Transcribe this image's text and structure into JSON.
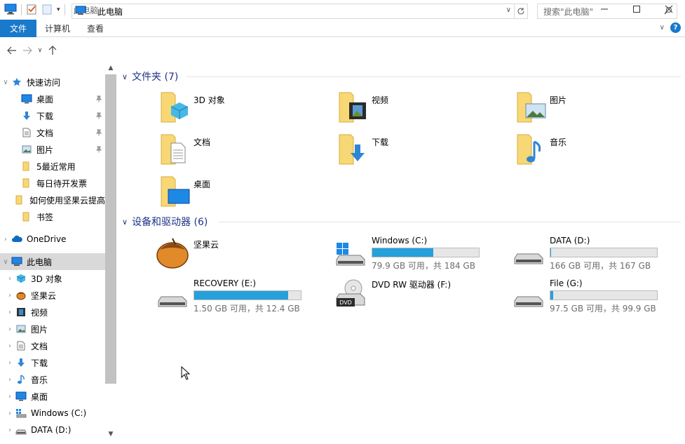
{
  "window": {
    "title": "此电脑",
    "controls": [
      "minimize",
      "maximize",
      "close"
    ]
  },
  "ribbon": {
    "tabs": [
      {
        "label": "文件",
        "active": true
      },
      {
        "label": "计算机",
        "active": false
      },
      {
        "label": "查看",
        "active": false
      }
    ]
  },
  "address": {
    "path": "此电脑",
    "search_placeholder": "搜索\"此电脑\""
  },
  "nav": {
    "quick_access": "快速访问",
    "quick_items": [
      {
        "label": "桌面",
        "icon": "desktop-icon",
        "pinned": true
      },
      {
        "label": "下载",
        "icon": "download-icon",
        "pinned": true
      },
      {
        "label": "文档",
        "icon": "document-icon",
        "pinned": true
      },
      {
        "label": "图片",
        "icon": "picture-icon",
        "pinned": true
      },
      {
        "label": "5最近常用",
        "icon": "folder-icon",
        "pinned": false
      },
      {
        "label": "每日待开发票",
        "icon": "folder-icon",
        "pinned": false
      },
      {
        "label": "如何使用坚果云提高",
        "icon": "folder-icon",
        "pinned": false
      },
      {
        "label": "书签",
        "icon": "folder-icon",
        "pinned": false
      }
    ],
    "onedrive": "OneDrive",
    "this_pc": "此电脑",
    "pc_items": [
      {
        "label": "3D 对象",
        "icon": "3d-objects-icon"
      },
      {
        "label": "坚果云",
        "icon": "nutstore-icon"
      },
      {
        "label": "视频",
        "icon": "video-icon"
      },
      {
        "label": "图片",
        "icon": "picture-icon"
      },
      {
        "label": "文档",
        "icon": "document-icon"
      },
      {
        "label": "下载",
        "icon": "download-icon"
      },
      {
        "label": "音乐",
        "icon": "music-icon"
      },
      {
        "label": "桌面",
        "icon": "desktop-icon"
      },
      {
        "label": "Windows (C:)",
        "icon": "windows-drive-icon"
      },
      {
        "label": "DATA (D:)",
        "icon": "drive-icon"
      }
    ]
  },
  "content": {
    "folders_header": "文件夹 (7)",
    "folders": [
      {
        "name": "3D 对象",
        "icon": "3d-objects-icon"
      },
      {
        "name": "视频",
        "icon": "video-icon"
      },
      {
        "name": "图片",
        "icon": "picture-icon"
      },
      {
        "name": "文档",
        "icon": "document-icon"
      },
      {
        "name": "下载",
        "icon": "download-icon"
      },
      {
        "name": "音乐",
        "icon": "music-icon"
      },
      {
        "name": "桌面",
        "icon": "desktop-icon"
      }
    ],
    "devices_header": "设备和驱动器 (6)",
    "devices": [
      {
        "name": "坚果云",
        "icon": "nutstore-icon",
        "has_bar": false
      },
      {
        "name": "Windows (C:)",
        "icon": "windows-drive-icon",
        "has_bar": true,
        "used_fraction": 0.57,
        "free_text": "79.9 GB 可用，共 184 GB"
      },
      {
        "name": "DATA (D:)",
        "icon": "drive-icon",
        "has_bar": true,
        "used_fraction": 0.006,
        "free_text": "166 GB 可用，共 167 GB"
      },
      {
        "name": "RECOVERY (E:)",
        "icon": "drive-icon",
        "has_bar": true,
        "used_fraction": 0.88,
        "free_text": "1.50 GB 可用，共 12.4 GB"
      },
      {
        "name": "DVD RW 驱动器 (F:)",
        "icon": "dvd-drive-icon",
        "has_bar": false
      },
      {
        "name": "File (G:)",
        "icon": "drive-icon",
        "has_bar": true,
        "used_fraction": 0.025,
        "free_text": "97.5 GB 可用，共 99.9 GB"
      }
    ]
  },
  "colors": {
    "accent": "#1979ca",
    "bar_fill": "#26a0da",
    "header_text": "#1e3287",
    "folder_yellow": "#f8d775"
  }
}
